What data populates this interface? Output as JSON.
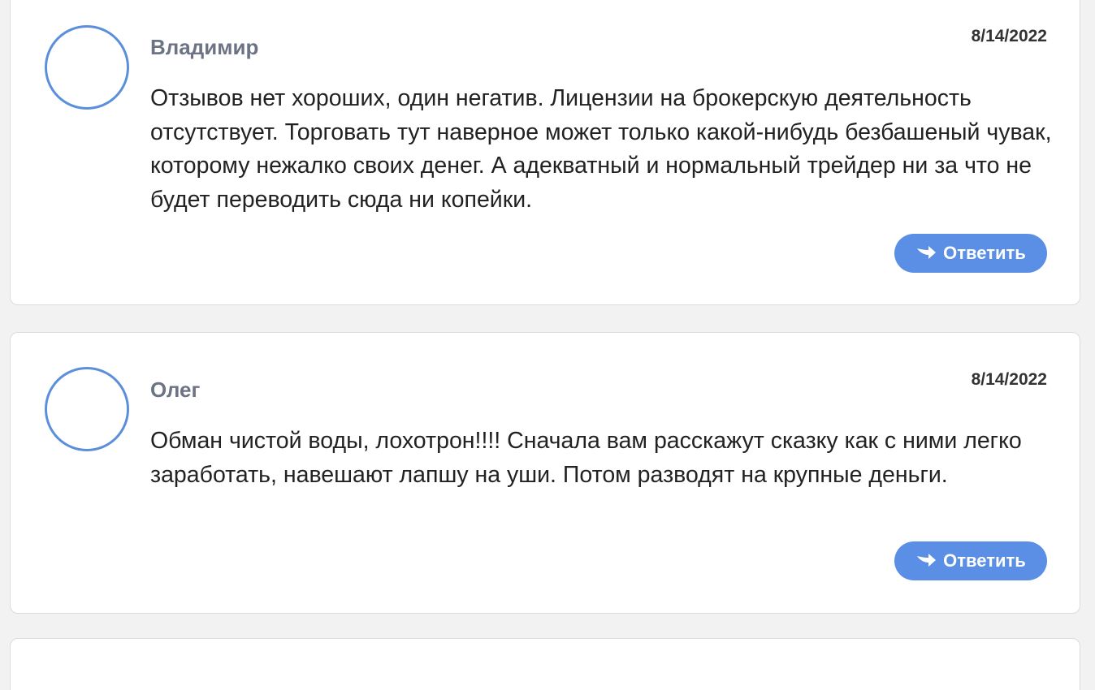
{
  "comments": [
    {
      "author": "Владимир",
      "date": "8/14/2022",
      "text": "Отзывов нет хороших, один негатив. Лицензии на брокерскую деятельность отсутствует. Торговать тут наверное может только какой-нибудь безбашеный чувак, которому нежалко своих денег. А адекватный и нормальный трейдер ни за что не будет переводить сюда ни копейки.",
      "reply_label": "Ответить"
    },
    {
      "author": "Олег",
      "date": "8/14/2022",
      "text": "Обман чистой воды, лохотрон!!!! Сначала вам расскажут сказку как с ними легко заработать, навешают лапшу на уши. Потом разводят на крупные деньги.",
      "reply_label": "Ответить"
    }
  ],
  "icons": {
    "reply": "reply-arrow-icon",
    "avatar": "avatar-circle"
  },
  "colors": {
    "accent": "#5b8fe6",
    "avatar_border": "#5b8fdb",
    "author": "#6b7385",
    "background": "#f2f2f2"
  }
}
